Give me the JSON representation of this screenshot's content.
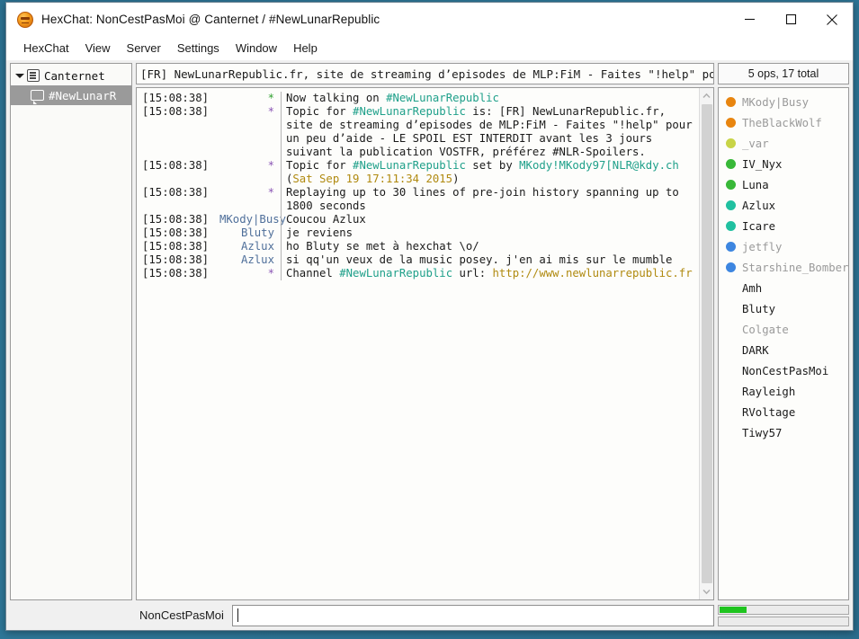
{
  "window": {
    "title": "HexChat: NonCestPasMoi @ Canternet / #NewLunarRepublic",
    "app_icon": "hexchat-logo-icon",
    "minimize_label": "—",
    "maximize_label": "□",
    "close_label": "✕"
  },
  "menubar": {
    "items": [
      {
        "label": "HexChat"
      },
      {
        "label": "View"
      },
      {
        "label": "Server"
      },
      {
        "label": "Settings"
      },
      {
        "label": "Window"
      },
      {
        "label": "Help"
      }
    ]
  },
  "sidebar": {
    "server": {
      "label": "Canternet",
      "expanded": true
    },
    "channels": [
      {
        "label": "#NewLunarR",
        "selected": true
      }
    ]
  },
  "topic": {
    "text": "[FR] NewLunarRepublic.fr, site de streaming d’episodes de MLP:FiM - Faites \"!help\" pour un pe"
  },
  "chat": {
    "lines": [
      {
        "time": "[15:08:38]",
        "nick": "*",
        "nick_class": "c-star-green",
        "parts": [
          {
            "t": "Now talking on ",
            "c": ""
          },
          {
            "t": "#NewLunarRepublic",
            "c": "c-chan"
          }
        ]
      },
      {
        "time": "[15:08:38]",
        "nick": "*",
        "nick_class": "c-star-purple",
        "parts": [
          {
            "t": "Topic for ",
            "c": ""
          },
          {
            "t": "#NewLunarRepublic",
            "c": "c-chan"
          },
          {
            "t": " is: [FR] NewLunarRepublic.fr, site de streaming d’episodes de MLP:FiM - Faites \"!help\" pour un peu d’aide - LE SPOIL EST INTERDIT avant les 3 jours suivant la publication VOSTFR, préférez #NLR-Spoilers.",
            "c": ""
          }
        ]
      },
      {
        "time": "[15:08:38]",
        "nick": "*",
        "nick_class": "c-star-purple",
        "parts": [
          {
            "t": "Topic for ",
            "c": ""
          },
          {
            "t": "#NewLunarRepublic",
            "c": "c-chan"
          },
          {
            "t": " set by ",
            "c": ""
          },
          {
            "t": "MKody!MKody97[NLR@kdy.ch",
            "c": "c-host"
          },
          {
            "t": " (",
            "c": ""
          },
          {
            "t": "Sat Sep 19 17:11:34 2015",
            "c": "c-date"
          },
          {
            "t": ")",
            "c": ""
          }
        ]
      },
      {
        "time": "[15:08:38]",
        "nick": "*",
        "nick_class": "c-star-purple",
        "parts": [
          {
            "t": "Replaying up to 30 lines of pre-join history spanning up to 1800 seconds",
            "c": ""
          }
        ]
      },
      {
        "time": "[15:08:38]",
        "nick": "MKody|Busy",
        "nick_class": "c-nick",
        "parts": [
          {
            "t": "Coucou Azlux",
            "c": ""
          }
        ]
      },
      {
        "time": "[15:08:38]",
        "nick": "Bluty",
        "nick_class": "c-nick",
        "parts": [
          {
            "t": "je reviens",
            "c": ""
          }
        ]
      },
      {
        "time": "[15:08:38]",
        "nick": "Azlux",
        "nick_class": "c-nick",
        "parts": [
          {
            "t": "ho Bluty se met à hexchat \\o/",
            "c": ""
          }
        ]
      },
      {
        "time": "[15:08:38]",
        "nick": "Azlux",
        "nick_class": "c-nick",
        "parts": [
          {
            "t": "si qq'un veux de la music posey. j'en ai mis sur le mumble",
            "c": ""
          }
        ]
      },
      {
        "time": "[15:08:38]",
        "nick": "*",
        "nick_class": "c-star-purple",
        "parts": [
          {
            "t": "Channel ",
            "c": ""
          },
          {
            "t": "#NewLunarRepublic",
            "c": "c-chan"
          },
          {
            "t": " url: ",
            "c": ""
          },
          {
            "t": "http://www.newlunarrepublic.fr",
            "c": "c-url"
          }
        ]
      }
    ]
  },
  "userlist": {
    "header": "5 ops, 17 total",
    "users": [
      {
        "name": "MKody|Busy",
        "color": "#e8850f",
        "away": true
      },
      {
        "name": "TheBlackWolf",
        "color": "#e8850f",
        "away": true
      },
      {
        "name": "_var",
        "color": "#c8d447",
        "away": true
      },
      {
        "name": "IV_Nyx",
        "color": "#38b838",
        "away": false
      },
      {
        "name": "Luna",
        "color": "#38b838",
        "away": false
      },
      {
        "name": "Azlux",
        "color": "#20c0a0",
        "away": false
      },
      {
        "name": "Icare",
        "color": "#20c0a0",
        "away": false
      },
      {
        "name": "jetfly",
        "color": "#3d86e0",
        "away": true
      },
      {
        "name": "Starshine_Bomber",
        "color": "#3d86e0",
        "away": true
      },
      {
        "name": "Amh",
        "color": "",
        "away": false
      },
      {
        "name": "Bluty",
        "color": "",
        "away": false
      },
      {
        "name": "Colgate",
        "color": "",
        "away": true
      },
      {
        "name": "DARK",
        "color": "",
        "away": false
      },
      {
        "name": "NonCestPasMoi",
        "color": "",
        "away": false
      },
      {
        "name": "Rayleigh",
        "color": "",
        "away": false
      },
      {
        "name": "RVoltage",
        "color": "",
        "away": false
      },
      {
        "name": "Tiwy57",
        "color": "",
        "away": false
      }
    ]
  },
  "inputbar": {
    "nick": "NonCestPasMoi",
    "value": "",
    "placeholder": ""
  },
  "status": {
    "lag_meter_percent": 22,
    "lag_color": "#1fc41f",
    "throttle_meter_percent": 0
  },
  "scrollbar": {
    "up_arrow_icon": "chevron-up-icon",
    "down_arrow_icon": "chevron-down-icon"
  }
}
